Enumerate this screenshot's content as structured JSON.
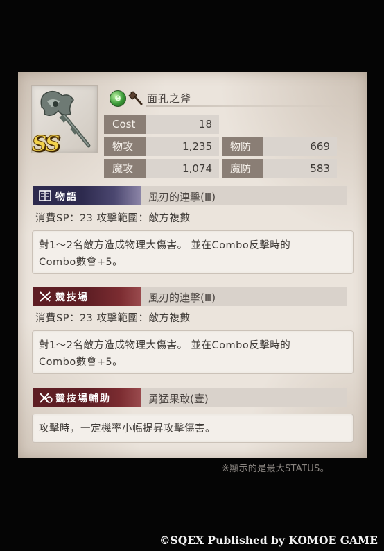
{
  "weapon": {
    "rarity": "SS",
    "name": "面孔之斧",
    "element_icon": "green-orb-icon",
    "type_icon": "axe-icon"
  },
  "stats": {
    "cost_label": "Cost",
    "cost_value": "18",
    "patk_label": "物攻",
    "patk_value": "1,235",
    "pdef_label": "物防",
    "pdef_value": "669",
    "matk_label": "魔攻",
    "matk_value": "1,074",
    "mdef_label": "魔防",
    "mdef_value": "583"
  },
  "story": {
    "tag": "物語",
    "skill": "風刃的連擊(Ⅲ)",
    "info": "消費SP：23  攻擊範圍：敵方複數",
    "desc_line1": "對1～2名敵方造成物理大傷害。 並在Combo反擊時的",
    "desc_line2": "Combo數會+5。"
  },
  "arena": {
    "tag": "競技場",
    "skill": "風刃的連擊(Ⅲ)",
    "info": "消費SP：23  攻擊範圍：敵方複數",
    "desc_line1": "對1～2名敵方造成物理大傷害。 並在Combo反擊時的",
    "desc_line2": "Combo數會+5。"
  },
  "arena_support": {
    "tag": "競技場輔助",
    "skill": "勇猛果敢(壹)",
    "desc": "攻擊時，一定機率小幅提昇攻擊傷害。"
  },
  "footer": {
    "note": "※顯示的是最大STATUS。",
    "copyright": "©SQEX Published by KOMOE GAME"
  },
  "colors": {
    "card_bg": "#ebe4dc",
    "stat_label_bg": "#8a7e75",
    "story_tag": "#2d2a4e",
    "arena_tag": "#5e1e24",
    "rarity_gold": "#f2d34a"
  }
}
